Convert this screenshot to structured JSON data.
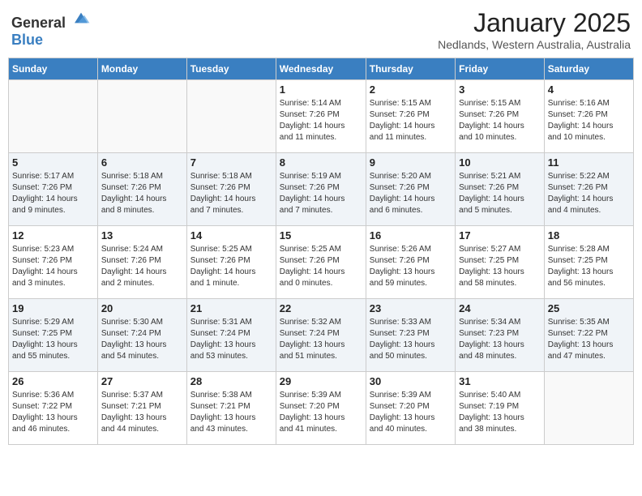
{
  "header": {
    "logo_general": "General",
    "logo_blue": "Blue",
    "month": "January 2025",
    "location": "Nedlands, Western Australia, Australia"
  },
  "days_of_week": [
    "Sunday",
    "Monday",
    "Tuesday",
    "Wednesday",
    "Thursday",
    "Friday",
    "Saturday"
  ],
  "weeks": [
    [
      {
        "day": "",
        "info": ""
      },
      {
        "day": "",
        "info": ""
      },
      {
        "day": "",
        "info": ""
      },
      {
        "day": "1",
        "info": "Sunrise: 5:14 AM\nSunset: 7:26 PM\nDaylight: 14 hours\nand 11 minutes."
      },
      {
        "day": "2",
        "info": "Sunrise: 5:15 AM\nSunset: 7:26 PM\nDaylight: 14 hours\nand 11 minutes."
      },
      {
        "day": "3",
        "info": "Sunrise: 5:15 AM\nSunset: 7:26 PM\nDaylight: 14 hours\nand 10 minutes."
      },
      {
        "day": "4",
        "info": "Sunrise: 5:16 AM\nSunset: 7:26 PM\nDaylight: 14 hours\nand 10 minutes."
      }
    ],
    [
      {
        "day": "5",
        "info": "Sunrise: 5:17 AM\nSunset: 7:26 PM\nDaylight: 14 hours\nand 9 minutes."
      },
      {
        "day": "6",
        "info": "Sunrise: 5:18 AM\nSunset: 7:26 PM\nDaylight: 14 hours\nand 8 minutes."
      },
      {
        "day": "7",
        "info": "Sunrise: 5:18 AM\nSunset: 7:26 PM\nDaylight: 14 hours\nand 7 minutes."
      },
      {
        "day": "8",
        "info": "Sunrise: 5:19 AM\nSunset: 7:26 PM\nDaylight: 14 hours\nand 7 minutes."
      },
      {
        "day": "9",
        "info": "Sunrise: 5:20 AM\nSunset: 7:26 PM\nDaylight: 14 hours\nand 6 minutes."
      },
      {
        "day": "10",
        "info": "Sunrise: 5:21 AM\nSunset: 7:26 PM\nDaylight: 14 hours\nand 5 minutes."
      },
      {
        "day": "11",
        "info": "Sunrise: 5:22 AM\nSunset: 7:26 PM\nDaylight: 14 hours\nand 4 minutes."
      }
    ],
    [
      {
        "day": "12",
        "info": "Sunrise: 5:23 AM\nSunset: 7:26 PM\nDaylight: 14 hours\nand 3 minutes."
      },
      {
        "day": "13",
        "info": "Sunrise: 5:24 AM\nSunset: 7:26 PM\nDaylight: 14 hours\nand 2 minutes."
      },
      {
        "day": "14",
        "info": "Sunrise: 5:25 AM\nSunset: 7:26 PM\nDaylight: 14 hours\nand 1 minute."
      },
      {
        "day": "15",
        "info": "Sunrise: 5:25 AM\nSunset: 7:26 PM\nDaylight: 14 hours\nand 0 minutes."
      },
      {
        "day": "16",
        "info": "Sunrise: 5:26 AM\nSunset: 7:26 PM\nDaylight: 13 hours\nand 59 minutes."
      },
      {
        "day": "17",
        "info": "Sunrise: 5:27 AM\nSunset: 7:25 PM\nDaylight: 13 hours\nand 58 minutes."
      },
      {
        "day": "18",
        "info": "Sunrise: 5:28 AM\nSunset: 7:25 PM\nDaylight: 13 hours\nand 56 minutes."
      }
    ],
    [
      {
        "day": "19",
        "info": "Sunrise: 5:29 AM\nSunset: 7:25 PM\nDaylight: 13 hours\nand 55 minutes."
      },
      {
        "day": "20",
        "info": "Sunrise: 5:30 AM\nSunset: 7:24 PM\nDaylight: 13 hours\nand 54 minutes."
      },
      {
        "day": "21",
        "info": "Sunrise: 5:31 AM\nSunset: 7:24 PM\nDaylight: 13 hours\nand 53 minutes."
      },
      {
        "day": "22",
        "info": "Sunrise: 5:32 AM\nSunset: 7:24 PM\nDaylight: 13 hours\nand 51 minutes."
      },
      {
        "day": "23",
        "info": "Sunrise: 5:33 AM\nSunset: 7:23 PM\nDaylight: 13 hours\nand 50 minutes."
      },
      {
        "day": "24",
        "info": "Sunrise: 5:34 AM\nSunset: 7:23 PM\nDaylight: 13 hours\nand 48 minutes."
      },
      {
        "day": "25",
        "info": "Sunrise: 5:35 AM\nSunset: 7:22 PM\nDaylight: 13 hours\nand 47 minutes."
      }
    ],
    [
      {
        "day": "26",
        "info": "Sunrise: 5:36 AM\nSunset: 7:22 PM\nDaylight: 13 hours\nand 46 minutes."
      },
      {
        "day": "27",
        "info": "Sunrise: 5:37 AM\nSunset: 7:21 PM\nDaylight: 13 hours\nand 44 minutes."
      },
      {
        "day": "28",
        "info": "Sunrise: 5:38 AM\nSunset: 7:21 PM\nDaylight: 13 hours\nand 43 minutes."
      },
      {
        "day": "29",
        "info": "Sunrise: 5:39 AM\nSunset: 7:20 PM\nDaylight: 13 hours\nand 41 minutes."
      },
      {
        "day": "30",
        "info": "Sunrise: 5:39 AM\nSunset: 7:20 PM\nDaylight: 13 hours\nand 40 minutes."
      },
      {
        "day": "31",
        "info": "Sunrise: 5:40 AM\nSunset: 7:19 PM\nDaylight: 13 hours\nand 38 minutes."
      },
      {
        "day": "",
        "info": ""
      }
    ]
  ]
}
